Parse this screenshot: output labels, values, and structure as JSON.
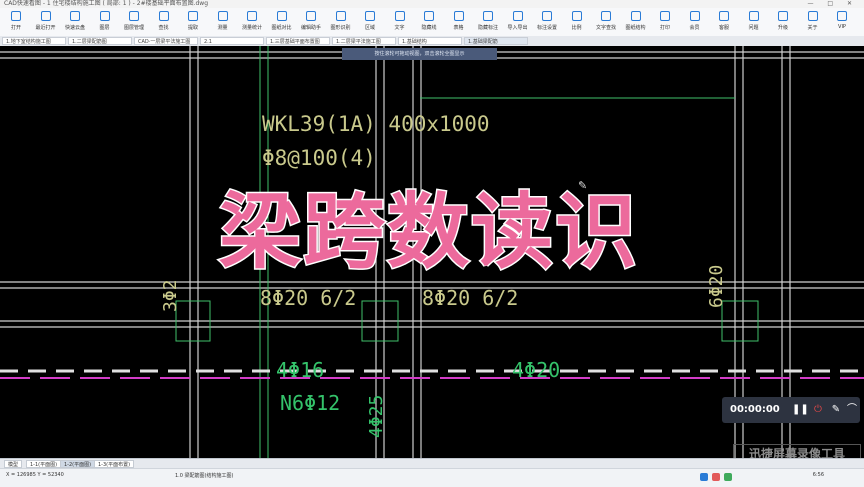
{
  "titlebar": {
    "app_title": "CAD快速看图 - 1 住宅楼结构施工图 ( 局部: 1 ) - 2#楼基础平面布置图.dwg",
    "window_controls": "— □ ✕"
  },
  "toolbar": {
    "items": [
      {
        "label": "打开",
        "icon": "open-icon"
      },
      {
        "label": "最近打开",
        "icon": "recent-icon"
      },
      {
        "label": "快速云盘",
        "icon": "cloud-icon"
      },
      {
        "label": "图层",
        "icon": "layer-icon"
      },
      {
        "label": "图层管理",
        "icon": "layer-manager-icon"
      },
      {
        "label": "查找",
        "icon": "find-icon"
      },
      {
        "label": "提取",
        "icon": "extract-icon"
      },
      {
        "label": "测量",
        "icon": "measure-icon"
      },
      {
        "label": "测量统计",
        "icon": "measure-stats-icon"
      },
      {
        "label": "图纸对比",
        "icon": "compare-icon"
      },
      {
        "label": "编辑助手",
        "icon": "edit-helper-icon"
      },
      {
        "label": "图形识别",
        "icon": "recognize-icon"
      },
      {
        "label": "区域",
        "icon": "area-icon"
      },
      {
        "label": "文字",
        "icon": "text-icon"
      },
      {
        "label": "隐藏线",
        "icon": "hide-line-icon"
      },
      {
        "label": "表格",
        "icon": "table-icon"
      },
      {
        "label": "隐藏标注",
        "icon": "hide-dim-icon"
      },
      {
        "label": "导入导出",
        "icon": "import-export-icon"
      },
      {
        "label": "标注设置",
        "icon": "dim-settings-icon"
      },
      {
        "label": "比例",
        "icon": "scale-icon"
      },
      {
        "label": "文字查找",
        "icon": "text-find-icon"
      },
      {
        "label": "图纸结构",
        "icon": "structure-icon"
      },
      {
        "label": "打印",
        "icon": "print-icon"
      },
      {
        "label": "会员",
        "icon": "vip-icon"
      },
      {
        "label": "客服",
        "icon": "service-icon"
      },
      {
        "label": "问题",
        "icon": "help-icon"
      },
      {
        "label": "升级",
        "icon": "upgrade-icon"
      },
      {
        "label": "关于",
        "icon": "about-icon"
      },
      {
        "label": "VIP",
        "icon": "vip-badge-icon"
      }
    ]
  },
  "tabs": [
    {
      "label": "1.地下室结构施工图",
      "active": false
    },
    {
      "label": "1.二层梁配筋图",
      "active": false
    },
    {
      "label": "CAD·一层梁平法施工图",
      "active": false
    },
    {
      "label": "2.1",
      "active": false
    },
    {
      "label": "1.三层基础平面布置图",
      "active": false
    },
    {
      "label": "1.二层梁平法施工图",
      "active": false
    },
    {
      "label": "1.基础结构",
      "active": false
    },
    {
      "label": "1.基础梁配筋",
      "active": true
    }
  ],
  "hint_bar": "按住滚轮可拖动视图，双击滚轮全图显示",
  "cad_labels": {
    "beam_name": "WKL39(1A) 400x1000",
    "stirrup": "Φ8@100(4)",
    "bottom_bars_left": "8Φ20 6/2",
    "bottom_bars_right": "8Φ20 6/2",
    "left_vertical": "3Φ2",
    "right_vertical": "6Φ20",
    "side_bars_left": "4Φ16",
    "torsion_bars": "N6Φ12",
    "mid_bars": "4Φ20",
    "col_vertical": "4Φ25"
  },
  "overlay_title": "梁跨数读识",
  "recorder": {
    "time": "00:00:00",
    "pause_icon": "pause-icon",
    "stop_icon": "stop-icon",
    "pen_icon": "pen-icon",
    "brush_icon": "brush-icon"
  },
  "watermark": "迅捷屏幕录像工具",
  "sheets": [
    {
      "label": "模型",
      "active": false
    },
    {
      "label": "1-1(平面图)",
      "active": false
    },
    {
      "label": "1-2(平面图)",
      "active": true
    },
    {
      "label": "1-3(平面布置)",
      "active": false
    }
  ],
  "status": {
    "coords": "X = 126985  Y = 52340",
    "message": "1.0 梁配筋图(结构施工图)",
    "time": "6:56"
  }
}
